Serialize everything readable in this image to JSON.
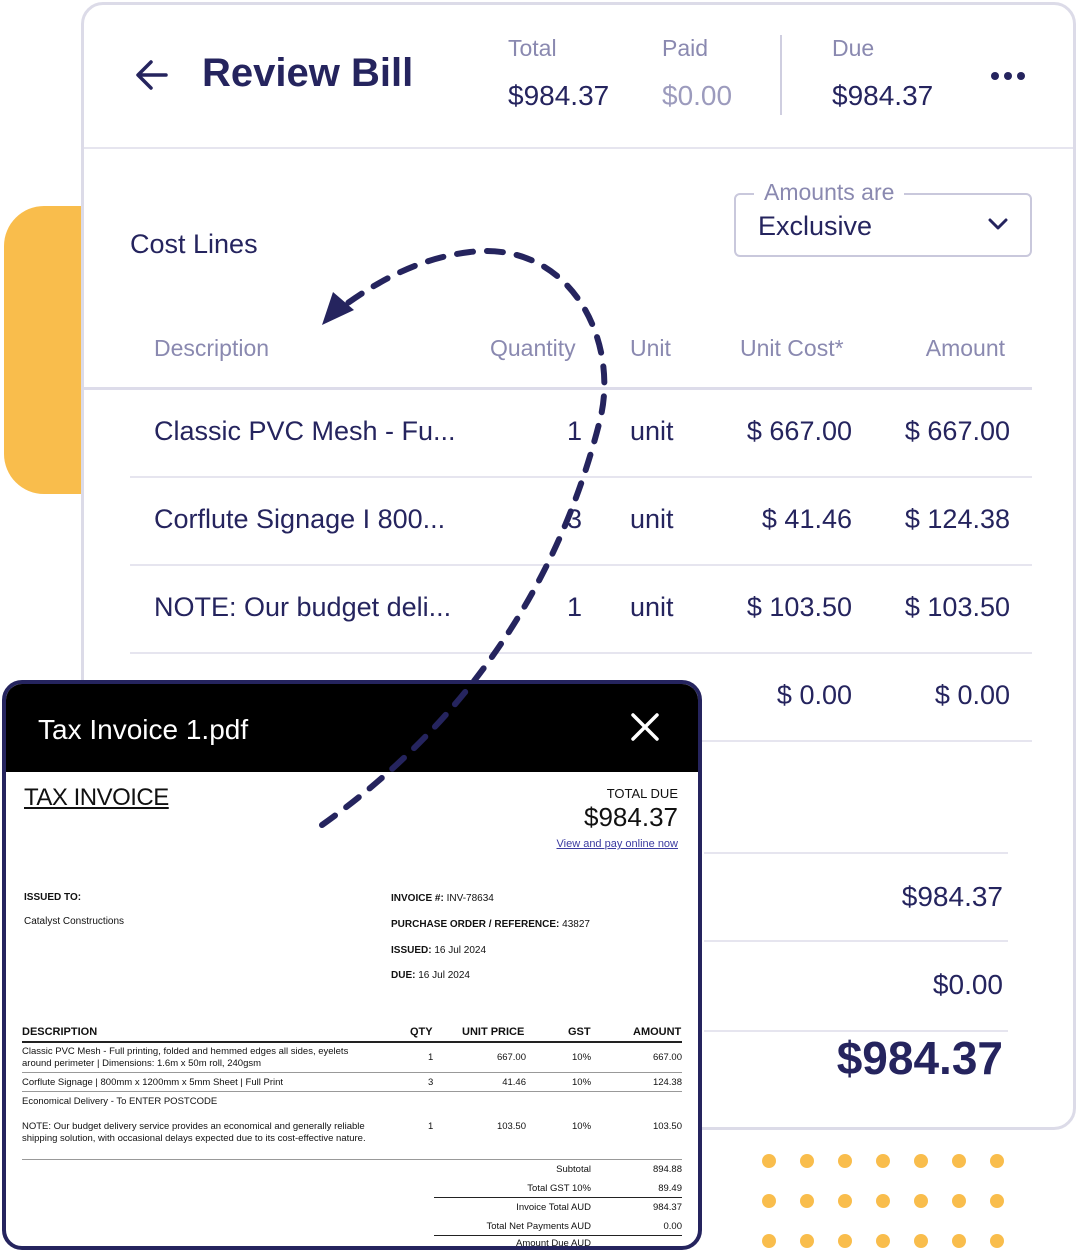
{
  "header": {
    "title": "Review Bill",
    "total_label": "Total",
    "total_value": "$984.37",
    "paid_label": "Paid",
    "paid_value": "$0.00",
    "due_label": "Due",
    "due_value": "$984.37",
    "icons": {
      "back": "arrow-left-icon",
      "more": "more-horizontal-icon"
    }
  },
  "cost_lines": {
    "title": "Cost Lines",
    "amounts_label": "Amounts are",
    "amounts_value": "Exclusive",
    "columns": [
      "Description",
      "Quantity",
      "Unit",
      "Unit Cost*",
      "Amount"
    ],
    "rows": [
      {
        "description": "Classic PVC Mesh - Fu...",
        "quantity": "1",
        "unit": "unit",
        "unit_cost": "$ 667.00",
        "amount": "$ 667.00"
      },
      {
        "description": "Corflute Signage I 800...",
        "quantity": "3",
        "unit": "unit",
        "unit_cost": "$ 41.46",
        "amount": "$ 124.38"
      },
      {
        "description": "NOTE: Our budget deli...",
        "quantity": "1",
        "unit": "unit",
        "unit_cost": "$ 103.50",
        "amount": "$ 103.50"
      },
      {
        "description": "",
        "quantity": "",
        "unit": "",
        "unit_cost": "$ 0.00",
        "amount": "$ 0.00"
      }
    ],
    "totals": [
      "$984.37",
      "$0.00",
      "$984.37"
    ]
  },
  "pdf": {
    "filename": "Tax Invoice 1.pdf",
    "heading": "TAX INVOICE",
    "total_due_label": "TOTAL DUE",
    "total_due_value": "$984.37",
    "pay_link": "View and pay online now",
    "issued_to_label": "ISSUED TO:",
    "issued_to_value": "Catalyst Constructions",
    "invoice_no_label": "INVOICE #:",
    "invoice_no_value": "INV-78634",
    "po_label": "PURCHASE ORDER / REFERENCE:",
    "po_value": "43827",
    "issued_label": "ISSUED:",
    "issued_value": "16 Jul 2024",
    "due_label": "DUE:",
    "due_value": "16 Jul 2024",
    "table_headers": [
      "DESCRIPTION",
      "QTY",
      "UNIT PRICE",
      "GST",
      "AMOUNT"
    ],
    "lines": [
      {
        "description": "Classic PVC Mesh - Full printing, folded and hemmed edges all sides, eyelets around perimeter | Dimensions: 1.6m x 50m roll, 240gsm",
        "qty": "1",
        "unit_price": "667.00",
        "gst": "10%",
        "amount": "667.00"
      },
      {
        "description": "Corflute Signage | 800mm x 1200mm x 5mm Sheet | Full Print",
        "qty": "3",
        "unit_price": "41.46",
        "gst": "10%",
        "amount": "124.38"
      },
      {
        "description": "Economical Delivery - To ENTER POSTCODE",
        "qty": "",
        "unit_price": "",
        "gst": "",
        "amount": ""
      },
      {
        "description": "NOTE: Our budget delivery service provides an economical and generally reliable shipping solution, with occasional delays expected due to its cost-effective nature.",
        "qty": "1",
        "unit_price": "103.50",
        "gst": "10%",
        "amount": "103.50"
      }
    ],
    "summary": [
      {
        "label": "Subtotal",
        "value": "894.88"
      },
      {
        "label": "Total GST 10%",
        "value": "89.49"
      },
      {
        "label": "Invoice Total AUD",
        "value": "984.37"
      },
      {
        "label": "Total Net Payments AUD",
        "value": "0.00"
      },
      {
        "label": "Amount Due AUD",
        "value": ""
      }
    ]
  },
  "colors": {
    "navy": "#25245e",
    "muted": "#8a89b0",
    "accent_yellow": "#f9bd4c"
  }
}
